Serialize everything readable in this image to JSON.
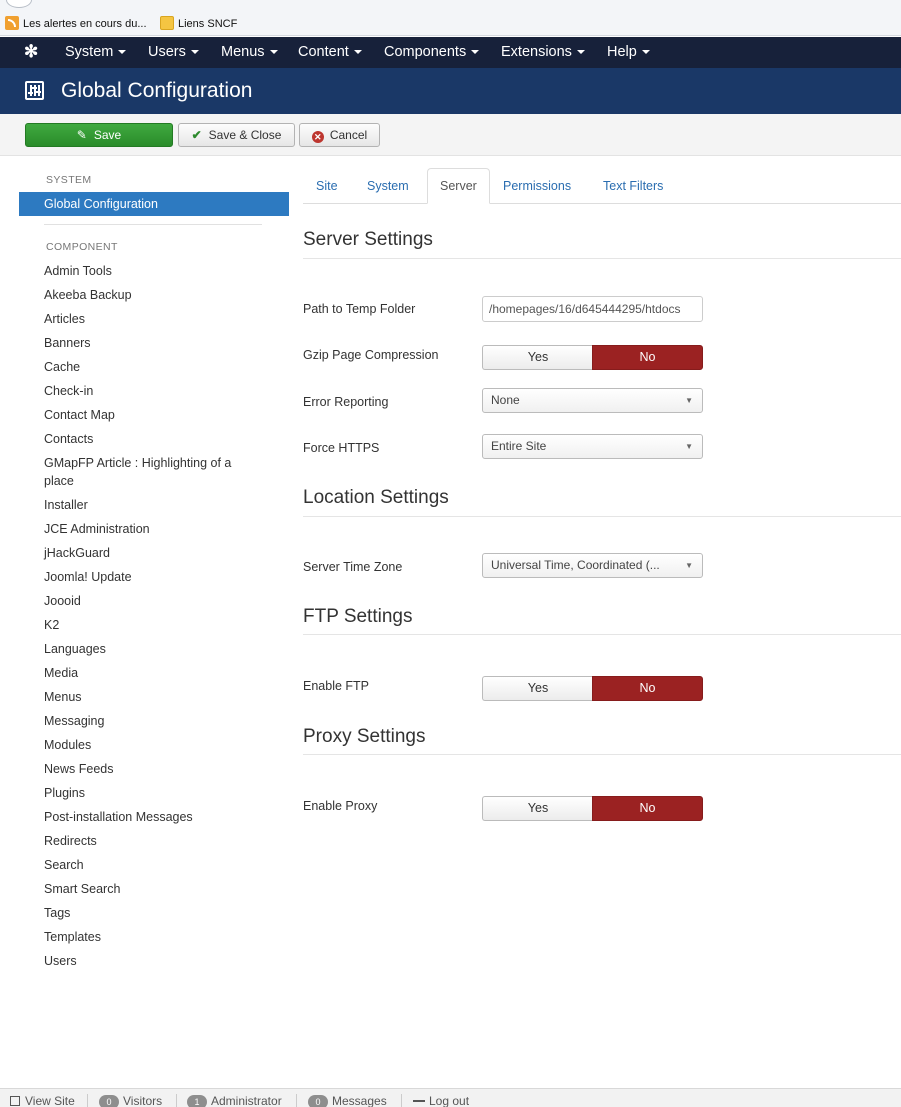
{
  "bookmarks": [
    {
      "label": "Les alertes en cours du...",
      "icon": "rss-icon"
    },
    {
      "label": "Liens SNCF",
      "icon": "folder-icon"
    }
  ],
  "topnav": {
    "logo_icon": "joomla-icon",
    "items": [
      {
        "label": "System"
      },
      {
        "label": "Users"
      },
      {
        "label": "Menus"
      },
      {
        "label": "Content"
      },
      {
        "label": "Components"
      },
      {
        "label": "Extensions"
      },
      {
        "label": "Help"
      }
    ]
  },
  "header": {
    "icon": "equalizer-icon",
    "title": "Global Configuration"
  },
  "toolbar": {
    "save_label": "Save",
    "save_close_label": "Save & Close",
    "cancel_label": "Cancel"
  },
  "sidebar": {
    "system_heading": "SYSTEM",
    "active_item": "Global Configuration",
    "component_heading": "COMPONENT",
    "items": [
      "Admin Tools",
      "Akeeba Backup",
      "Articles",
      "Banners",
      "Cache",
      "Check-in",
      "Contact Map",
      "Contacts",
      "GMapFP Article : Highlighting of a place",
      "Installer",
      "JCE Administration",
      "jHackGuard",
      "Joomla! Update",
      "Joooid",
      "K2",
      "Languages",
      "Media",
      "Menus",
      "Messaging",
      "Modules",
      "News Feeds",
      "Plugins",
      "Post-installation Messages",
      "Redirects",
      "Search",
      "Smart Search",
      "Tags",
      "Templates",
      "Users"
    ]
  },
  "tabs": [
    {
      "label": "Site",
      "active": false
    },
    {
      "label": "System",
      "active": false
    },
    {
      "label": "Server",
      "active": true
    },
    {
      "label": "Permissions",
      "active": false
    },
    {
      "label": "Text Filters",
      "active": false
    }
  ],
  "server_settings": {
    "title": "Server Settings",
    "temp_path_label": "Path to Temp Folder",
    "temp_path_value": "/homepages/16/d645444295/htdocs",
    "gzip_label": "Gzip Page Compression",
    "gzip_value": "No",
    "error_reporting_label": "Error Reporting",
    "error_reporting_value": "None",
    "force_https_label": "Force HTTPS",
    "force_https_value": "Entire Site"
  },
  "location_settings": {
    "title": "Location Settings",
    "timezone_label": "Server Time Zone",
    "timezone_value": "Universal Time, Coordinated (..."
  },
  "ftp_settings": {
    "title": "FTP Settings",
    "enable_ftp_label": "Enable FTP",
    "enable_ftp_value": "No"
  },
  "proxy_settings": {
    "title": "Proxy Settings",
    "enable_proxy_label": "Enable Proxy",
    "enable_proxy_value": "No"
  },
  "toggle": {
    "yes": "Yes",
    "no": "No"
  },
  "statusbar": {
    "view_site_label": "View Site",
    "visitors_count": "0",
    "visitors_label": "Visitors",
    "admin_count": "1",
    "admin_label": "Administrator",
    "messages_count": "0",
    "messages_label": "Messages",
    "logout_label": "Log out"
  },
  "colors": {
    "topnav": "#17213a",
    "header": "#1a3867",
    "save_button": "#3fa93f",
    "active_sidebar": "#2d7ac1",
    "toggle_no": "#9b2222",
    "link": "#2a6db0"
  }
}
